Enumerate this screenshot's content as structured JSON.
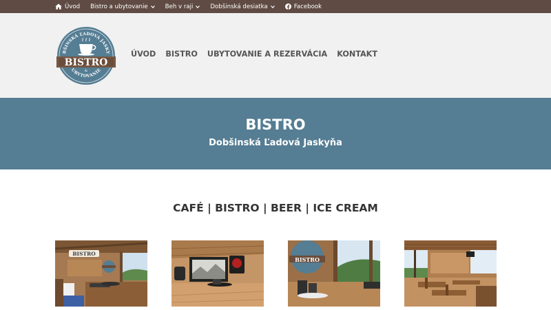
{
  "topbar": {
    "items": [
      {
        "label": "Úvod",
        "icon": "home-icon",
        "has_dropdown": false
      },
      {
        "label": "Bistro a ubytovanie",
        "icon": null,
        "has_dropdown": true
      },
      {
        "label": "Beh v raji",
        "icon": null,
        "has_dropdown": true
      },
      {
        "label": "Dobšinská desiatka",
        "icon": null,
        "has_dropdown": true
      },
      {
        "label": "Facebook",
        "icon": "facebook-icon",
        "has_dropdown": false
      }
    ]
  },
  "logo": {
    "arc_text": "DOBŠINSKÁ ĽADOVÁ JASKYŇA",
    "main": "BISTRO",
    "amp": "&",
    "bottom_text": "UBYTOVANIE"
  },
  "nav": {
    "items": [
      "ÚVOD",
      "BISTRO",
      "UBYTOVANIE A REZERVÁCIA",
      "KONTAKT"
    ]
  },
  "hero": {
    "title": "BISTRO",
    "subtitle": "Dobšinská Ľadová Jaskyňa"
  },
  "section": {
    "title": "CAFÉ | BISTRO | BEER | ICE CREAM"
  },
  "gallery": {
    "photos": [
      "bistro-terrace-photo",
      "bistro-table-photo",
      "bistro-logo-table-photo",
      "bistro-interior-photo"
    ],
    "thumb_1_sign": "BISTRO",
    "thumb_3_sign": "BISTRO"
  },
  "colors": {
    "topbar_bg": "#5f4b43",
    "header_bg": "#f1f1f1",
    "hero_bg": "#557d93",
    "nav_text": "#555555",
    "heading_text": "#333333"
  }
}
